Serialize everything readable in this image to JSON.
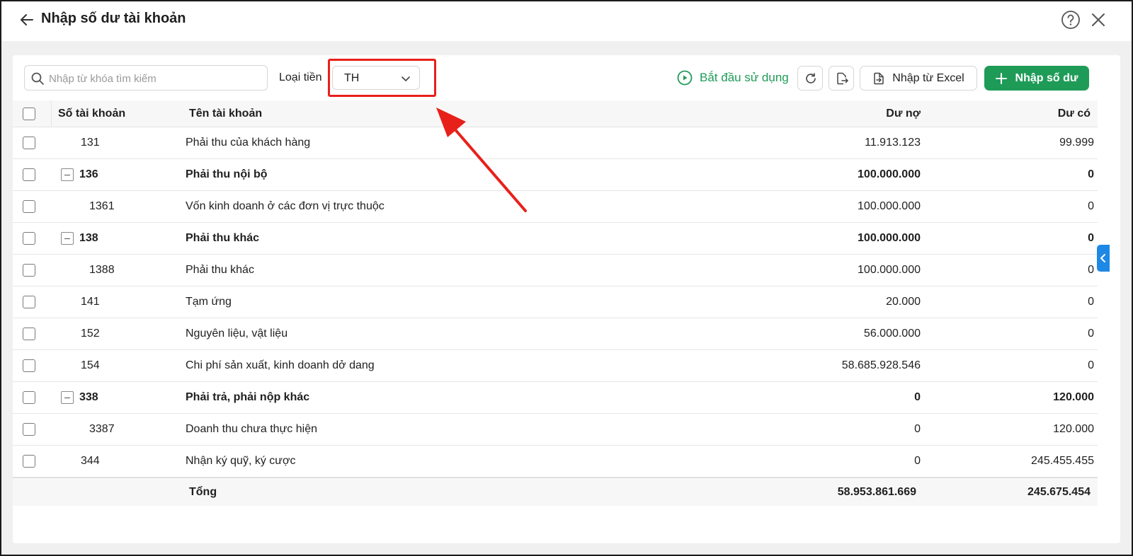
{
  "header": {
    "title": "Nhập số dư tài khoản",
    "back_icon": "arrow-left-icon",
    "help_icon": "help-circle-icon",
    "close_icon": "close-icon"
  },
  "toolbar": {
    "search_placeholder": "Nhập từ khóa tìm kiếm",
    "search_value": "",
    "currency_label": "Loại tiền",
    "currency_value": "TH",
    "start_label": "Bắt đầu sử dụng",
    "import_excel_label": "Nhập từ Excel",
    "add_balance_label": "Nhập số dư",
    "refresh_icon": "refresh-icon",
    "export_icon": "export-file-icon"
  },
  "table": {
    "columns": {
      "account_no": "Số tài khoản",
      "account_name": "Tên tài khoản",
      "debit": "Dư nợ",
      "credit": "Dư có"
    },
    "rows": [
      {
        "no": "131",
        "name": "Phải thu của khách hàng",
        "debit": "11.913.123",
        "credit": "99.999",
        "level": 0,
        "parent": false
      },
      {
        "no": "136",
        "name": "Phải thu nội bộ",
        "debit": "100.000.000",
        "credit": "0",
        "level": 0,
        "parent": true
      },
      {
        "no": "1361",
        "name": "Vốn kinh doanh ở các đơn vị trực thuộc",
        "debit": "100.000.000",
        "credit": "0",
        "level": 1,
        "parent": false
      },
      {
        "no": "138",
        "name": "Phải thu khác",
        "debit": "100.000.000",
        "credit": "0",
        "level": 0,
        "parent": true
      },
      {
        "no": "1388",
        "name": "Phải thu khác",
        "debit": "100.000.000",
        "credit": "0",
        "level": 1,
        "parent": false
      },
      {
        "no": "141",
        "name": "Tạm ứng",
        "debit": "20.000",
        "credit": "0",
        "level": 0,
        "parent": false
      },
      {
        "no": "152",
        "name": "Nguyên liệu, vật liệu",
        "debit": "56.000.000",
        "credit": "0",
        "level": 0,
        "parent": false
      },
      {
        "no": "154",
        "name": "Chi phí sản xuất, kinh doanh dở dang",
        "debit": "58.685.928.546",
        "credit": "0",
        "level": 0,
        "parent": false
      },
      {
        "no": "338",
        "name": "Phải trả, phải nộp khác",
        "debit": "0",
        "credit": "120.000",
        "level": 0,
        "parent": true
      },
      {
        "no": "3387",
        "name": "Doanh thu chưa thực hiện",
        "debit": "0",
        "credit": "120.000",
        "level": 1,
        "parent": false
      },
      {
        "no": "344",
        "name": "Nhận ký quỹ, ký cược",
        "debit": "0",
        "credit": "245.455.455",
        "level": 0,
        "parent": false
      }
    ],
    "total": {
      "label": "Tổng",
      "debit": "58.953.861.669",
      "credit": "245.675.454"
    }
  },
  "colors": {
    "accent_green": "#1f9b58",
    "annotation_red": "#e8201a",
    "side_tab_blue": "#1e88e5"
  }
}
